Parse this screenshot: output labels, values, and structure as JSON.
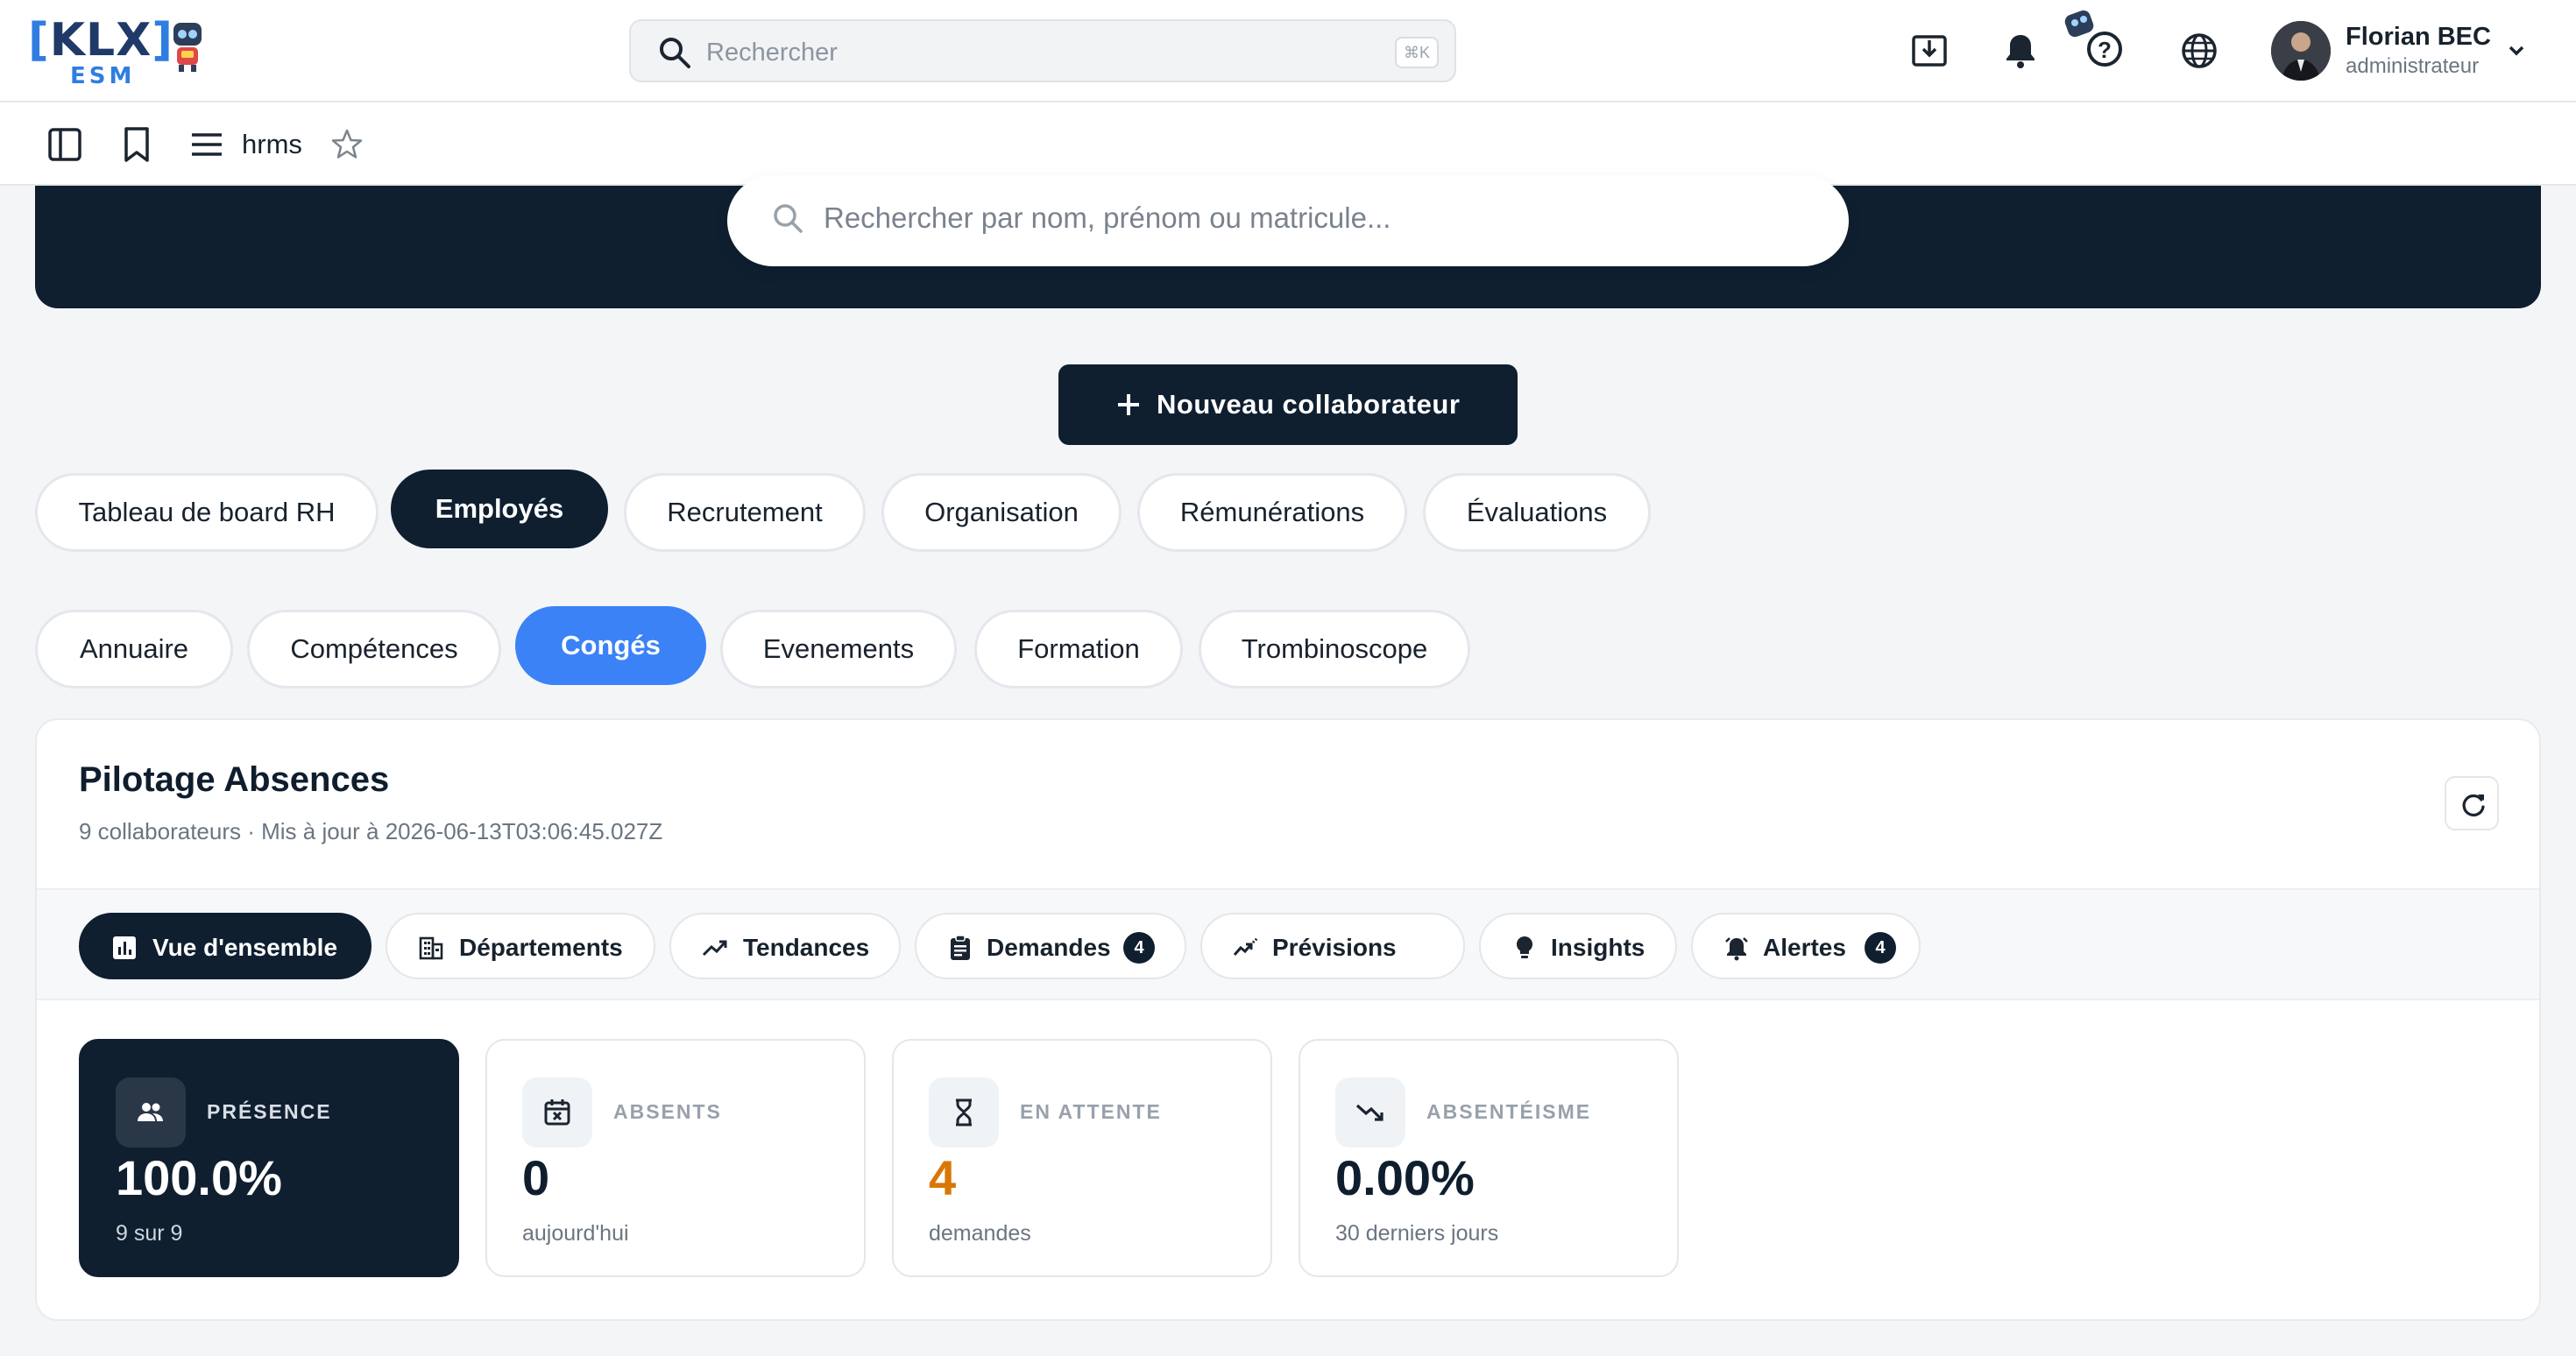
{
  "header": {
    "logo_text": "KLX",
    "logo_sub": "ESM",
    "search_placeholder": "Rechercher",
    "search_shortcut": "⌘K",
    "user": {
      "name": "Florian BEC",
      "role": "administrateur"
    }
  },
  "subbar": {
    "app_name": "hrms"
  },
  "hero": {
    "search_placeholder": "Rechercher par nom, prénom ou matricule..."
  },
  "cta": {
    "label": "Nouveau collaborateur"
  },
  "main_tabs": [
    {
      "label": "Tableau de board RH",
      "active": false
    },
    {
      "label": "Employés",
      "active": true
    },
    {
      "label": "Recrutement",
      "active": false
    },
    {
      "label": "Organisation",
      "active": false
    },
    {
      "label": "Rémunérations",
      "active": false
    },
    {
      "label": "Évaluations",
      "active": false
    }
  ],
  "sub_tabs": [
    {
      "label": "Annuaire",
      "active": false
    },
    {
      "label": "Compétences",
      "active": false
    },
    {
      "label": "Congés",
      "active": true
    },
    {
      "label": "Evenements",
      "active": false
    },
    {
      "label": "Formation",
      "active": false
    },
    {
      "label": "Trombinoscope",
      "active": false
    }
  ],
  "card": {
    "title": "Pilotage Absences",
    "subtitle": "9 collaborateurs · Mis à jour à 2026-06-13T03:06:45.027Z",
    "tabs": [
      {
        "label": "Vue d'ensemble",
        "icon": "bar-chart-icon",
        "active": true
      },
      {
        "label": "Départements",
        "icon": "building-icon",
        "active": false
      },
      {
        "label": "Tendances",
        "icon": "trending-up-icon",
        "active": false
      },
      {
        "label": "Demandes",
        "icon": "clipboard-icon",
        "badge": "4",
        "active": false
      },
      {
        "label": "Prévisions",
        "icon": "forecast-icon",
        "active": false
      },
      {
        "label": "Insights",
        "icon": "lightbulb-icon",
        "active": false
      },
      {
        "label": "Alertes",
        "icon": "alarm-icon",
        "badge": "4",
        "active": false
      }
    ],
    "kpis": [
      {
        "label": "PRÉSENCE",
        "value": "100.0%",
        "sub": "9 sur 9",
        "icon": "people-icon"
      },
      {
        "label": "ABSENTS",
        "value": "0",
        "sub": "aujourd'hui",
        "icon": "calendar-x-icon"
      },
      {
        "label": "EN ATTENTE",
        "value": "4",
        "sub": "demandes",
        "icon": "hourglass-icon"
      },
      {
        "label": "ABSENTÉISME",
        "value": "0.00%",
        "sub": "30 derniers jours",
        "icon": "trending-down-icon"
      }
    ]
  },
  "colors": {
    "navy": "#0f1f30",
    "blue": "#3b82f6",
    "orange": "#d97706"
  }
}
